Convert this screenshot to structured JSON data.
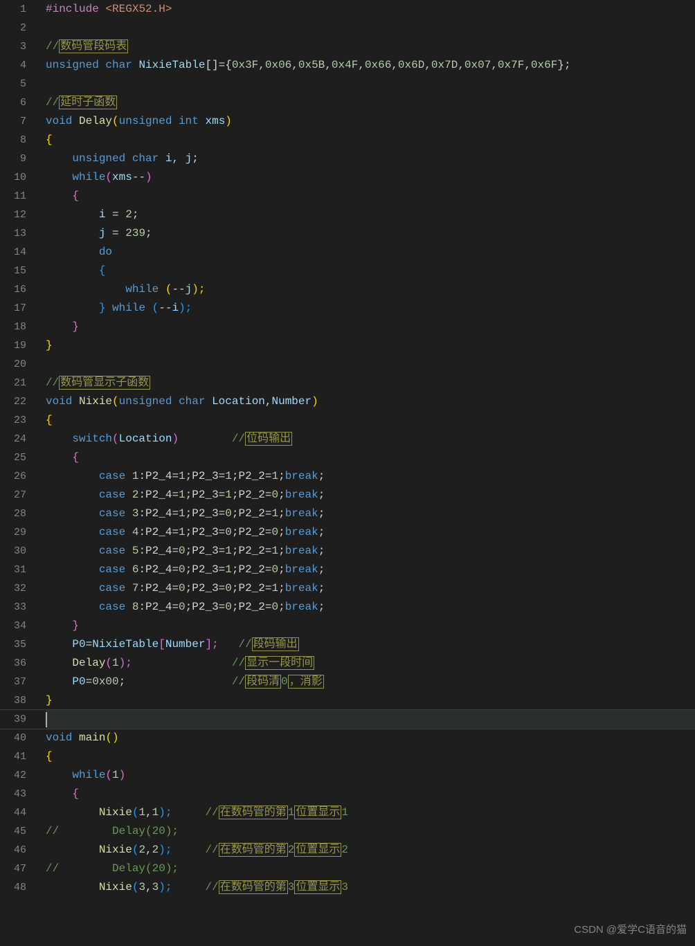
{
  "gutter": [
    "1",
    "2",
    "3",
    "4",
    "5",
    "6",
    "7",
    "8",
    "9",
    "10",
    "11",
    "12",
    "13",
    "14",
    "15",
    "16",
    "17",
    "18",
    "19",
    "20",
    "21",
    "22",
    "23",
    "24",
    "25",
    "26",
    "27",
    "28",
    "29",
    "30",
    "31",
    "32",
    "33",
    "34",
    "35",
    "36",
    "37",
    "38",
    "39",
    "40",
    "41",
    "42",
    "43",
    "44",
    "45",
    "46",
    "47",
    "48"
  ],
  "current_line_index": 38,
  "code": {
    "l1": {
      "pp": "#include",
      "open": "<",
      "hdr": "REGX52.H",
      "close": ">"
    },
    "l3": {
      "cm": "//",
      "cmh": "数码管段码表"
    },
    "l4": {
      "kw1": "unsigned",
      "kw2": "char",
      "id": "NixieTable",
      "tail": "[]={",
      "vals": "0x3F,0x06,0x5B,0x4F,0x66,0x6D,0x7D,0x07,0x7F,0x6F",
      "end": "};"
    },
    "l6": {
      "cm": "//",
      "cmh": "延时子函数"
    },
    "l7": {
      "kw": "void",
      "fn": "Delay",
      "op": "(",
      "ty1": "unsigned",
      "ty2": "int",
      "arg": "xms",
      "cp": ")"
    },
    "l8": {
      "br": "{"
    },
    "l9": {
      "ty1": "unsigned",
      "ty2": "char",
      "ids": "i, j",
      ";": ";"
    },
    "l10": {
      "kw": "while",
      "op": "(",
      "id": "xms",
      "dec": "--",
      "cp": ")"
    },
    "l11": {
      "br": "{"
    },
    "l12": {
      "id": "i",
      "eq": " = ",
      "num": "2",
      ";": ";"
    },
    "l13": {
      "id": "j",
      "eq": " = ",
      "num": "239",
      ";": ";"
    },
    "l14": {
      "kw": "do"
    },
    "l15": {
      "br": "{"
    },
    "l16": {
      "kw": "while",
      "op": " (",
      "dec": "--",
      "id": "j",
      "cp": ");"
    },
    "l17": {
      "br": "}",
      "kw": "while",
      "op": " (",
      "dec": "--",
      "id": "i",
      "cp": ");"
    },
    "l18": {
      "br": "}"
    },
    "l19": {
      "br": "}"
    },
    "l21": {
      "cm": "//",
      "cmh": "数码管显示子函数"
    },
    "l22": {
      "kw": "void",
      "fn": "Nixie",
      "op": "(",
      "ty1": "unsigned",
      "ty2": "char",
      "a1": "Location",
      "c": ",",
      "a2": "Number",
      "cp": ")"
    },
    "l23": {
      "br": "{"
    },
    "l24": {
      "kw": "switch",
      "op": "(",
      "id": "Location",
      "cp": ")",
      "cm": "//",
      "cmh": "位码输出"
    },
    "l25": {
      "br": "{"
    },
    "l26": {
      "kw": "case",
      "n": "1",
      "body": ":P2_4=",
      "v1": "1",
      ";P2_3=": ";P2_3=",
      "v2": "1",
      ";P2_2=": ";P2_2=",
      "v3": "1",
      "sc": ";",
      "bk": "break",
      ";2": ";"
    },
    "l27": {
      "kw": "case",
      "n": "2",
      "body": ":P2_4=",
      "v1": "1",
      ";P2_3=": ";P2_3=",
      "v2": "1",
      ";P2_2=": ";P2_2=",
      "v3": "0",
      "sc": ";",
      "bk": "break",
      ";2": ";"
    },
    "l28": {
      "kw": "case",
      "n": "3",
      "body": ":P2_4=",
      "v1": "1",
      ";P2_3=": ";P2_3=",
      "v2": "0",
      ";P2_2=": ";P2_2=",
      "v3": "1",
      "sc": ";",
      "bk": "break",
      ";2": ";"
    },
    "l29": {
      "kw": "case",
      "n": "4",
      "body": ":P2_4=",
      "v1": "1",
      ";P2_3=": ";P2_3=",
      "v2": "0",
      ";P2_2=": ";P2_2=",
      "v3": "0",
      "sc": ";",
      "bk": "break",
      ";2": ";"
    },
    "l30": {
      "kw": "case",
      "n": "5",
      "body": ":P2_4=",
      "v1": "0",
      ";P2_3=": ";P2_3=",
      "v2": "1",
      ";P2_2=": ";P2_2=",
      "v3": "1",
      "sc": ";",
      "bk": "break",
      ";2": ";"
    },
    "l31": {
      "kw": "case",
      "n": "6",
      "body": ":P2_4=",
      "v1": "0",
      ";P2_3=": ";P2_3=",
      "v2": "1",
      ";P2_2=": ";P2_2=",
      "v3": "0",
      "sc": ";",
      "bk": "break",
      ";2": ";"
    },
    "l32": {
      "kw": "case",
      "n": "7",
      "body": ":P2_4=",
      "v1": "0",
      ";P2_3=": ";P2_3=",
      "v2": "0",
      ";P2_2=": ";P2_2=",
      "v3": "1",
      "sc": ";",
      "bk": "break",
      ";2": ";"
    },
    "l33": {
      "kw": "case",
      "n": "8",
      "body": ":P2_4=",
      "v1": "0",
      ";P2_3=": ";P2_3=",
      "v2": "0",
      ";P2_2=": ";P2_2=",
      "v3": "0",
      "sc": ";",
      "bk": "break",
      ";2": ";"
    },
    "l34": {
      "br": "}"
    },
    "l35": {
      "id": "P0",
      "eq": "=",
      "id2": "NixieTable",
      "op": "[",
      "idx": "Number",
      "cp": "];",
      "cm": "//",
      "cmh": "段码输出"
    },
    "l36": {
      "fn": "Delay",
      "op": "(",
      "n": "1",
      "cp": ");",
      "cm": "//",
      "cmh": "显示一段时间"
    },
    "l37": {
      "id": "P0",
      "eq": "=",
      "n": "0x00",
      "sc": ";",
      "cm": "//",
      "cmh1": "段码清",
      "z": "0",
      "cmh2": "，消影"
    },
    "l38": {
      "br": "}"
    },
    "l40": {
      "kw": "void",
      "fn": "main",
      "op": "()"
    },
    "l41": {
      "br": "{"
    },
    "l42": {
      "kw": "while",
      "op": "(",
      "n": "1",
      "cp": ")"
    },
    "l43": {
      "br": "{"
    },
    "l44": {
      "fn": "Nixie",
      "op": "(",
      "n1": "1",
      "c": ",",
      "n2": "1",
      "cp": ");",
      "cm": "//",
      "cmh1": "在数码管的第",
      "z1": "1",
      "cmh2": "位置显示",
      "z2": "1"
    },
    "l45": {
      "cm": "//",
      "body": "        Delay(20);"
    },
    "l46": {
      "fn": "Nixie",
      "op": "(",
      "n1": "2",
      "c": ",",
      "n2": "2",
      "cp": ");",
      "cm": "//",
      "cmh1": "在数码管的第",
      "z1": "2",
      "cmh2": "位置显示",
      "z2": "2"
    },
    "l47": {
      "cm": "//",
      "body": "        Delay(20);"
    },
    "l48": {
      "fn": "Nixie",
      "op": "(",
      "n1": "3",
      "c": ",",
      "n2": "3",
      "cp": ");",
      "cm": "//",
      "cmh1": "在数码管的第",
      "z1": "3",
      "cmh2": "位置显示",
      "z2": "3"
    }
  },
  "watermark": "CSDN @爱学C语音的猫"
}
